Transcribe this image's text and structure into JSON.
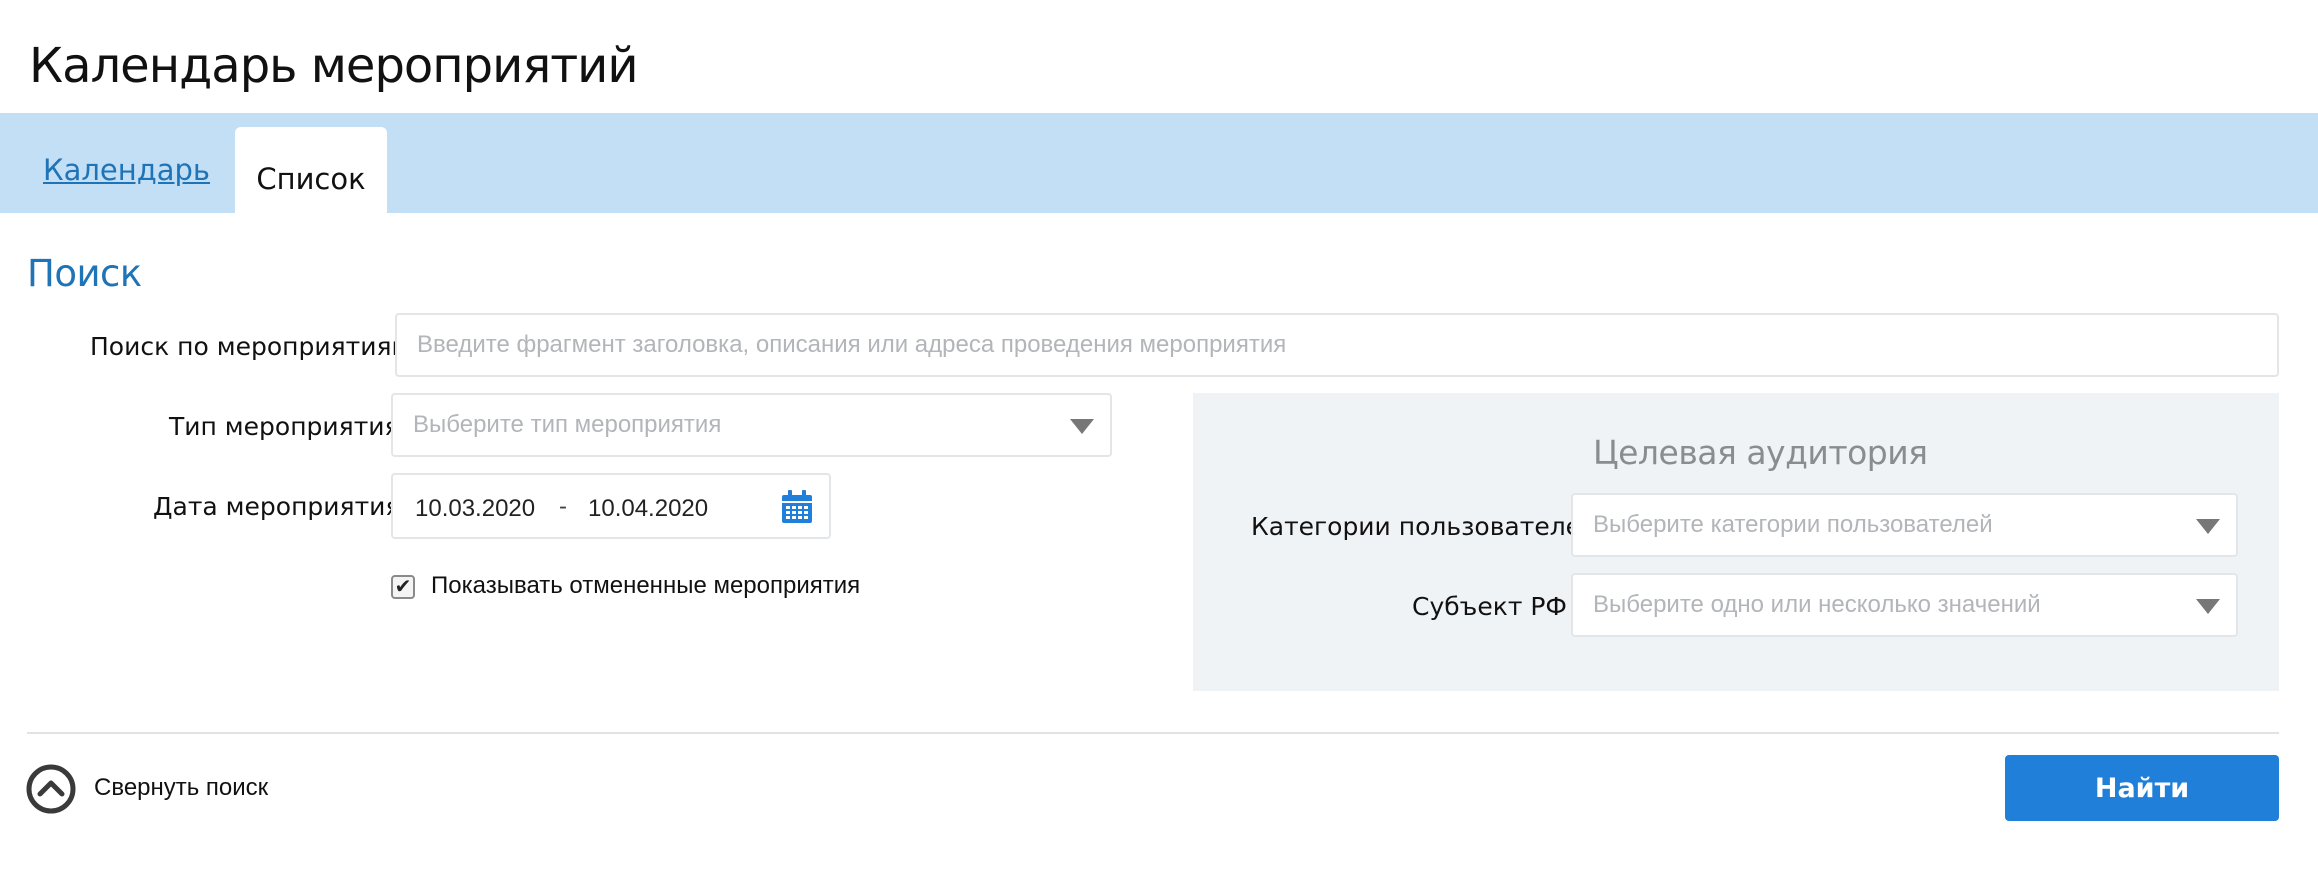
{
  "page": {
    "title": "Календарь мероприятий"
  },
  "tabs": [
    {
      "label": "Календарь",
      "active": false
    },
    {
      "label": "Список",
      "active": true
    }
  ],
  "search": {
    "title": "Поиск",
    "query_label": "Поиск по мероприятиям",
    "query_placeholder": "Введите фрагмент заголовка, описания или адреса проведения мероприятия",
    "type_label": "Тип мероприятия",
    "type_placeholder": "Выберите тип мероприятия",
    "date_label": "Дата мероприятия",
    "date_from": "10.03.2020",
    "date_separator": "-",
    "date_to": "10.04.2020",
    "show_cancelled_label": "Показывать отмененные мероприятия",
    "show_cancelled_checked": true
  },
  "audience": {
    "title": "Целевая аудитория",
    "categories_label": "Категории пользователей",
    "categories_placeholder": "Выберите категории пользователей",
    "region_label": "Субъект РФ",
    "region_placeholder": "Выберите одно или несколько значений"
  },
  "footer": {
    "collapse_label": "Свернуть поиск",
    "find_button": "Найти"
  },
  "icons": {
    "calendar": "calendar-icon",
    "dropdown": "chevron-down-icon",
    "collapse": "chevron-up-circle-icon",
    "check": "checkmark-icon"
  },
  "colors": {
    "accent": "#1f73b7",
    "button": "#1f7fd9",
    "tabbar": "#c3dff5",
    "panel": "#f0f3f6"
  }
}
